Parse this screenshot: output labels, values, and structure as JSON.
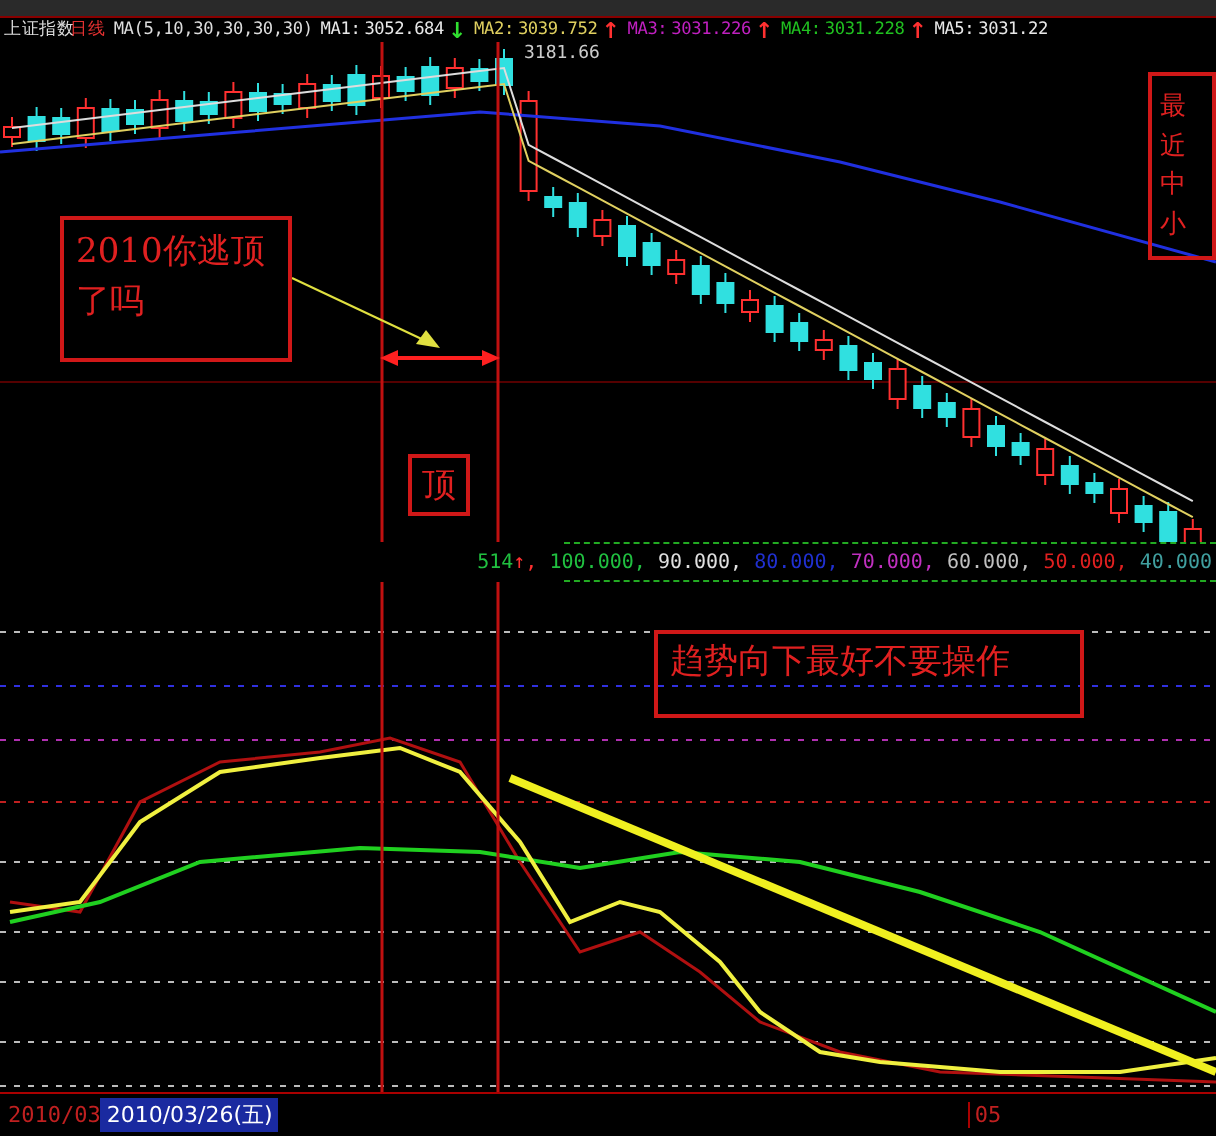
{
  "header": {
    "index_name": "上证指数",
    "period": "日线",
    "ma_params": "MA(5,10,30,30,30,30)",
    "ma_values": [
      {
        "label": "MA1:",
        "value": "3052.684",
        "arrow": {
          "text": "↓",
          "color": "#30e030"
        },
        "color": "#e8e8e8"
      },
      {
        "label": "MA2:",
        "value": "3039.752",
        "arrow": {
          "text": "↑",
          "color": "#ff3030"
        },
        "color": "#e0d060"
      },
      {
        "label": "MA3:",
        "value": "3031.226",
        "arrow": {
          "text": "↑",
          "color": "#ff3030"
        },
        "color": "#c020c0"
      },
      {
        "label": "MA4:",
        "value": "3031.228",
        "arrow": {
          "text": "↑",
          "color": "#ff3030"
        },
        "color": "#20c020"
      },
      {
        "label": "MA5:",
        "value": "3031.22",
        "color": "#e8e8e8"
      }
    ]
  },
  "main_chart": {
    "peak_label": "3181.66",
    "annotations": [
      {
        "kind": "question",
        "text": "2010你逃顶了吗"
      },
      {
        "kind": "top",
        "text": "顶"
      },
      {
        "kind": "edge",
        "text": "最近中小"
      }
    ]
  },
  "indicator_bar": {
    "reading": "514",
    "arrow": "↑,",
    "levels": [
      {
        "text": "100.000,",
        "color": "#20c040"
      },
      {
        "text": "90.000,",
        "color": "#e0e0e0"
      },
      {
        "text": "80.000,",
        "color": "#2030d0"
      },
      {
        "text": "70.000,",
        "color": "#c030c0"
      },
      {
        "text": "60.000,",
        "color": "#c0c0c0"
      },
      {
        "text": "50.000,",
        "color": "#e02020"
      },
      {
        "text": "40.000",
        "color": "#40a0a0"
      }
    ]
  },
  "indicator_chart": {
    "annotation": "趋势向下最好不要操作"
  },
  "date_bar": {
    "start": "2010/03",
    "cursor_date": "2010/03/26(五)",
    "month": "05"
  }
}
